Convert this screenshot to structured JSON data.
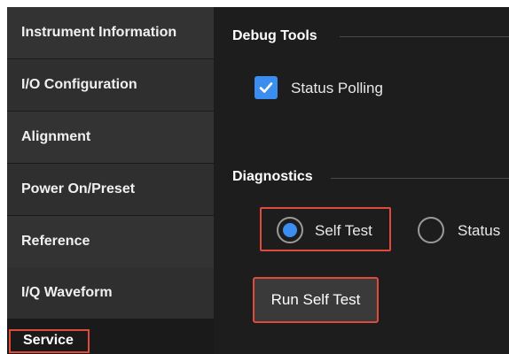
{
  "sidebar": {
    "items": [
      {
        "label": "Instrument Information"
      },
      {
        "label": "I/O Configuration"
      },
      {
        "label": "Alignment"
      },
      {
        "label": "Power On/Preset"
      },
      {
        "label": "Reference"
      },
      {
        "label": "I/Q Waveform"
      },
      {
        "label": "Service",
        "active": true
      }
    ]
  },
  "debug_tools": {
    "header": "Debug Tools",
    "status_polling": {
      "label": "Status Polling",
      "checked": true
    }
  },
  "diagnostics": {
    "header": "Diagnostics",
    "options": [
      {
        "label": "Self Test",
        "selected": true
      },
      {
        "label": "Status",
        "selected": false
      }
    ],
    "run_button": "Run Self Test"
  },
  "colors": {
    "accent": "#3b8ef0",
    "highlight": "#e04a3a",
    "panel": "#1d1d1d",
    "sidebar_item": "#333333"
  }
}
